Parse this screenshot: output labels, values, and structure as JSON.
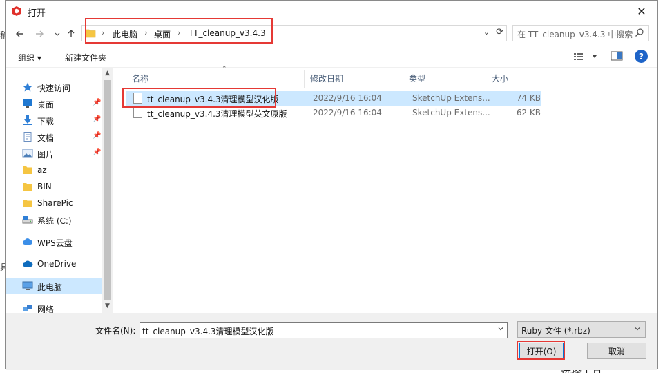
{
  "background": {
    "left_text_1": "稍",
    "left_text_2": "具",
    "bottom_text": "选择工具"
  },
  "window": {
    "title": "打开",
    "close": "✕"
  },
  "address": {
    "crumbs": [
      "此电脑",
      "桌面",
      "TT_cleanup_v3.4.3"
    ],
    "separator": "›",
    "search_placeholder": "在 TT_cleanup_v3.4.3 中搜索"
  },
  "toolbar": {
    "organize": "组织 ▾",
    "new_folder": "新建文件夹",
    "help": "?"
  },
  "nav": {
    "items": [
      {
        "label": "快速访问",
        "icon": "star-icon",
        "pinned": false
      },
      {
        "label": "桌面",
        "icon": "desktop-icon",
        "pinned": true
      },
      {
        "label": "下载",
        "icon": "download-icon",
        "pinned": true
      },
      {
        "label": "文档",
        "icon": "document-icon",
        "pinned": true
      },
      {
        "label": "图片",
        "icon": "picture-icon",
        "pinned": true
      },
      {
        "label": "az",
        "icon": "folder-icon",
        "pinned": false
      },
      {
        "label": "BIN",
        "icon": "folder-icon",
        "pinned": false
      },
      {
        "label": "SharePic",
        "icon": "folder-icon",
        "pinned": false
      },
      {
        "label": "系统 (C:)",
        "icon": "drive-icon",
        "pinned": false
      },
      {
        "label": "WPS云盘",
        "icon": "cloud-icon",
        "pinned": false
      },
      {
        "label": "OneDrive",
        "icon": "onedrive-icon",
        "pinned": false
      },
      {
        "label": "此电脑",
        "icon": "computer-icon",
        "pinned": false,
        "selected": true
      },
      {
        "label": "网络",
        "icon": "network-icon",
        "pinned": false
      }
    ]
  },
  "columns": {
    "name": "名称",
    "date": "修改日期",
    "type": "类型",
    "size": "大小"
  },
  "files": [
    {
      "name": "tt_cleanup_v3.4.3清理模型汉化版",
      "date": "2022/9/16 16:04",
      "type": "SketchUp Extens...",
      "size": "74 KB",
      "selected": true
    },
    {
      "name": "tt_cleanup_v3.4.3清理模型英文原版",
      "date": "2022/9/16 16:04",
      "type": "SketchUp Extens...",
      "size": "62 KB",
      "selected": false
    }
  ],
  "bottom": {
    "filename_label": "文件名(N):",
    "filename_value": "tt_cleanup_v3.4.3清理模型汉化版",
    "filetype": "Ruby 文件 (*.rbz)",
    "open_button": "打开(O)",
    "cancel_button": "取消"
  },
  "colors": {
    "highlight": "#e53935",
    "selection": "#cce8ff",
    "accent": "#0078d7"
  }
}
